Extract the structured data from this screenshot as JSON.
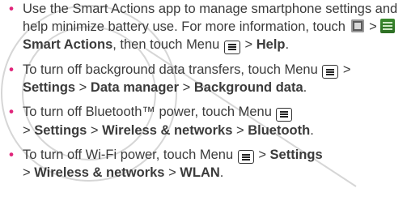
{
  "tips": [
    {
      "text_1": "Use the Smart Actions app to manage smartphone settings and help minimize battery use. For more information, touch ",
      "sep_1": " > ",
      "smart_actions": "Smart Actions",
      "text_2": ", then touch Menu ",
      "sep_2": " > ",
      "help": "Help",
      "text_end": "."
    },
    {
      "text_1": "To turn off background data transfers, touch Menu ",
      "sep_1": " > ",
      "settings": "Settings",
      "sep_2": " > ",
      "data_manager": "Data manager",
      "sep_3": " > ",
      "background_data": "Background data",
      "text_end": "."
    },
    {
      "text_1": "To turn off Bluetooth™ power, touch Menu ",
      "sep_1": " > ",
      "settings": "Settings",
      "sep_2": " > ",
      "wireless": "Wireless & networks",
      "sep_3": " > ",
      "bluetooth": "Bluetooth",
      "text_end": "."
    },
    {
      "text_1": "To turn off Wi-Fi power, touch Menu ",
      "sep_1": " > ",
      "settings": "Settings",
      "sep_2": " > ",
      "wireless": "Wireless & networks",
      "sep_3": " > ",
      "wlan": "WLAN",
      "text_end": "."
    }
  ],
  "bullet_char": "•",
  "bullet_color": "#e0257a",
  "icons": {
    "apps": "apps-launcher-icon",
    "smart_actions": "smart-actions-app-icon",
    "menu": "menu-key-icon"
  }
}
